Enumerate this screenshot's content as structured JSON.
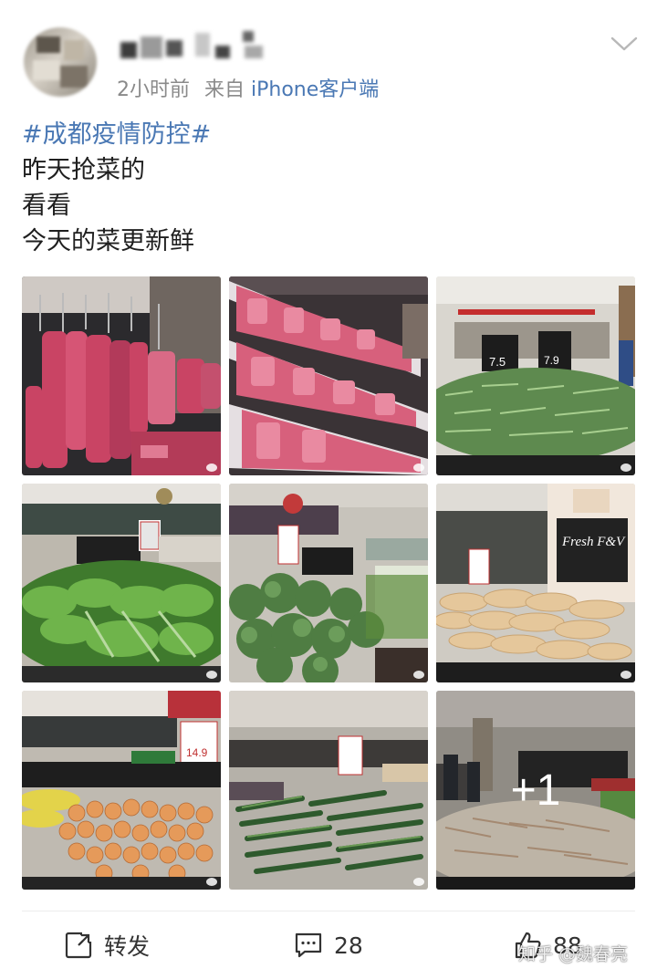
{
  "post": {
    "author": {
      "avatar_icon": "avatar-blurred",
      "name_blurred": true
    },
    "meta": {
      "time": "2小时前",
      "source_prefix": "来自",
      "source": "iPhone客户端"
    },
    "menu_icon": "chevron-down-icon",
    "hashtag": "#成都疫情防控#",
    "lines": [
      "昨天抢菜的",
      "看看",
      "今天的菜更新鲜"
    ],
    "images": [
      {
        "subject": "hanging pork",
        "sign": ""
      },
      {
        "subject": "pork cuts in fridge",
        "sign": ""
      },
      {
        "subject": "green beans display",
        "sign": "7.5"
      },
      {
        "subject": "leafy greens display",
        "sign": ""
      },
      {
        "subject": "broccoli display",
        "sign": ""
      },
      {
        "subject": "radish display",
        "sign": "Fresh F&V"
      },
      {
        "subject": "potatoes display",
        "sign": "14.9"
      },
      {
        "subject": "cucumbers display",
        "sign": ""
      },
      {
        "subject": "white radish display",
        "sign": "",
        "more_count": "+1"
      }
    ]
  },
  "actions": {
    "repost": {
      "icon": "share-icon",
      "label": "转发"
    },
    "comment": {
      "icon": "comment-icon",
      "count": "28"
    },
    "like": {
      "icon": "thumb-up-icon",
      "count": "88"
    }
  },
  "watermark": "知乎 @魏春亮"
}
